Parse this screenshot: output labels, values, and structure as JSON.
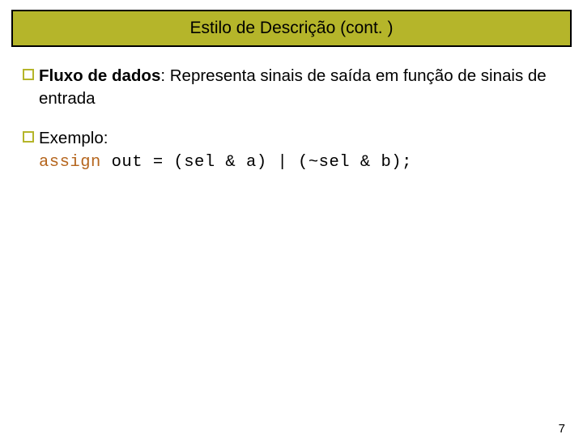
{
  "title": "Estilo de Descrição (cont. )",
  "blocks": {
    "b1": {
      "bold": "Fluxo de dados",
      "rest": ": Representa sinais de saída em função de sinais de entrada"
    },
    "b2": {
      "label": "Exemplo:"
    }
  },
  "code": {
    "keyword": "assign",
    "rest": " out = (sel & a) | (~sel & b);"
  },
  "pageNumber": "7"
}
